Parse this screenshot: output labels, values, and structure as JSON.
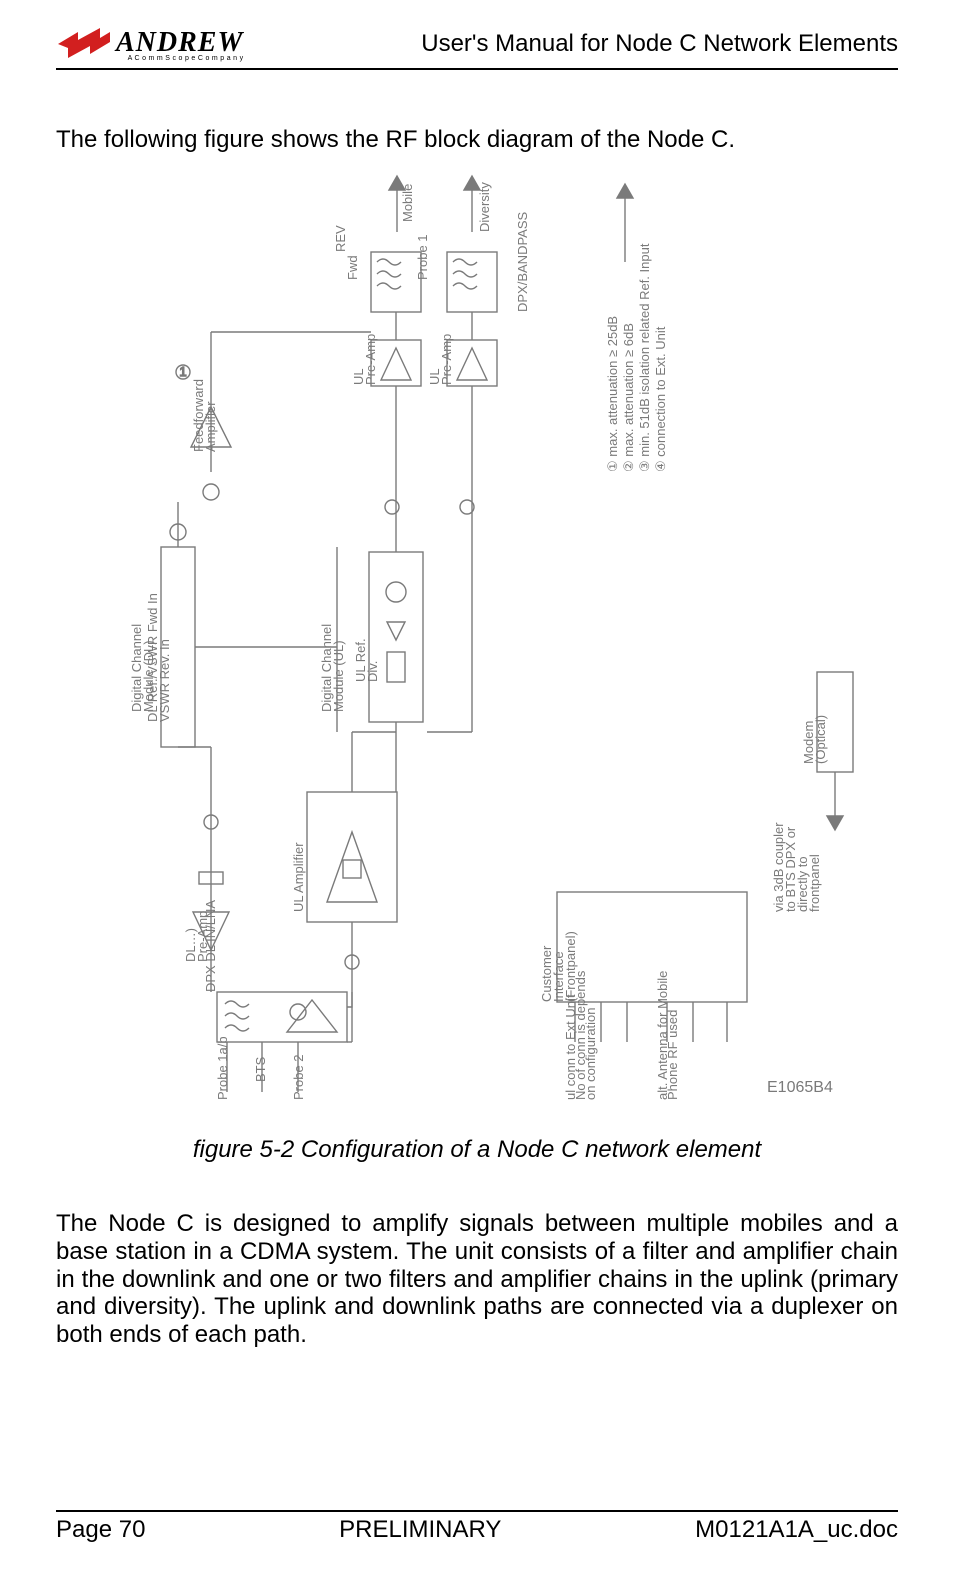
{
  "header": {
    "logo_text": "ANDREW",
    "logo_sub": "A  C o m m S c o p e  C o m p a n y",
    "title": "User's Manual for Node C Network Elements"
  },
  "intro": "The following figure shows the RF block diagram of the Node C.",
  "diagram": {
    "labels": {
      "digital_channel_dl": "Digital Channel\nModule (DL)",
      "digital_channel_ul": "Digital Channel\nModule (UL)",
      "feedforward_amp": "Feedforward\nAmplifier",
      "dl_ref_vswr": "DL Ref./VSWR Fwd In\nVSWR Rev. In",
      "ul_ref_div": "UL Ref.\nDiv.",
      "dl_pre_amp": "DL…)\nPre-Amp",
      "dpx_dl_in_lna": "DPX DL IN/LNA",
      "ul_amplifier": "UL Amplifier",
      "ul_pre_amp_1": "UL\nPre-Amp",
      "ul_pre_amp_2": "UL\nPre-Amp",
      "fwd": "Fwd",
      "rev": "REV",
      "mobile": "Mobile",
      "diversity": "Diversity",
      "dpx_bandpass": "DPX/BANDPASS",
      "customer_interface": "Customer\nInterface\n(Frontpanel)",
      "modem_optical": "Modem\n(Optical)",
      "via_coupler": "via 3dB coupler\nto BTS DPX or\ndirectly to\nfrontpanel",
      "probe_1a_b": "Probe 1a/b",
      "bts": "BTS",
      "probe_2": "Probe 2",
      "probe_1": "Probe 1",
      "note_ul_conn": "ul conn to Ext Unit\nNo of conn is depends\non configuration",
      "note_alt_antenna": "alt. Antenna for Mobile\nPhone RF used",
      "legend_1": "① max. attenuation ≥ 25dB",
      "legend_2": "② max. attenuation ≥ 6dB",
      "legend_3": "③ min. 51dB isolation related Ref. Input",
      "legend_4": "④ connection to Ext. Unit",
      "code": "E1065B4"
    }
  },
  "caption": "figure 5-2 Configuration of a Node C network element",
  "body": "The Node C is designed to amplify signals between multiple mobiles and a base station in a CDMA system. The unit consists of a filter and amplifier chain in the downlink and one or two filters and amplifier chains in the uplink (primary and diversity). The uplink and downlink paths are connected via a duplexer on both ends of each path.",
  "footer": {
    "page": "Page 70",
    "status": "PRELIMINARY",
    "docid": "M0121A1A_uc.doc"
  }
}
